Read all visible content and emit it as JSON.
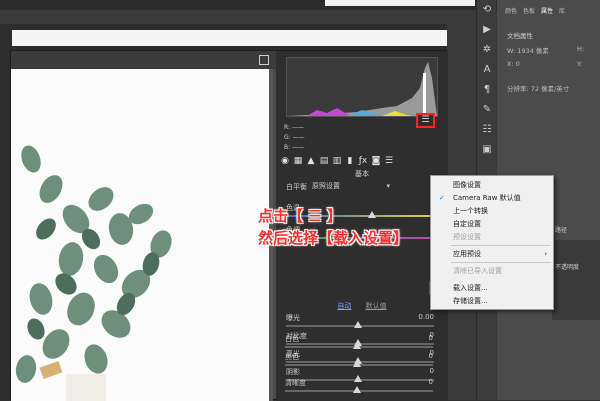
{
  "dialog": {
    "panel_title": "基本",
    "rgb": [
      "R: ——",
      "G: ——",
      "B: ——"
    ],
    "white_balance": {
      "label": "白平衡",
      "value": "原照设置"
    },
    "auto_links": {
      "auto": "自动",
      "default": "默认值"
    },
    "sliders": [
      {
        "label": "色温",
        "value": "",
        "pos": 0.55
      },
      {
        "label": "色调",
        "value": "",
        "pos": 0.55
      },
      {
        "label": "曝光",
        "value": "0.00",
        "pos": 0.5
      },
      {
        "label": "对比度",
        "value": "0",
        "pos": 0.5
      },
      {
        "label": "高光",
        "value": "0",
        "pos": 0.5
      },
      {
        "label": "阴影",
        "value": "0",
        "pos": 0.5
      },
      {
        "label": "白色",
        "value": "0",
        "pos": 0.5
      },
      {
        "label": "黑色",
        "value": "0",
        "pos": 0.5
      },
      {
        "label": "清晰度",
        "value": "0",
        "pos": 0.5
      }
    ],
    "menu_button_icon": "hamburger-menu-icon"
  },
  "context_menu": {
    "items": [
      {
        "label": "图像设置",
        "disabled": false,
        "checked": false,
        "submenu": false
      },
      {
        "label": "Camera Raw 默认值",
        "disabled": false,
        "checked": true,
        "submenu": false
      },
      {
        "label": "上一个转换",
        "disabled": false,
        "checked": false,
        "submenu": false
      },
      {
        "label": "自定设置",
        "disabled": false,
        "checked": false,
        "submenu": false
      },
      {
        "label": "预设设置",
        "disabled": true,
        "checked": false,
        "submenu": false
      },
      {
        "label": "应用预设",
        "disabled": false,
        "checked": false,
        "submenu": true
      },
      {
        "label": "清除已导入设置",
        "disabled": true,
        "checked": false,
        "submenu": false
      },
      {
        "label": "载入设置...",
        "disabled": false,
        "checked": false,
        "submenu": false
      },
      {
        "label": "存储设置...",
        "disabled": false,
        "checked": false,
        "submenu": false
      }
    ]
  },
  "annotation": {
    "line1": "点击【 ☰ 】",
    "line2": "然后选择【载入设置】"
  },
  "properties": {
    "tabs": [
      "颜色",
      "色板",
      "属性",
      "库"
    ],
    "active_tab": "属性",
    "title": "文档属性",
    "w": "W: 1934 像素",
    "h": "H:",
    "x": "X: 0",
    "y": "Y:",
    "resolution": "分辨率: 72 像素/英寸"
  },
  "layers": {
    "hint1": "路径",
    "hint2": "不透明度"
  },
  "colors": {
    "accent_red": "#ff2b2b",
    "menu_highlight": "#cde4fb",
    "link_blue": "#6fa8ff"
  }
}
